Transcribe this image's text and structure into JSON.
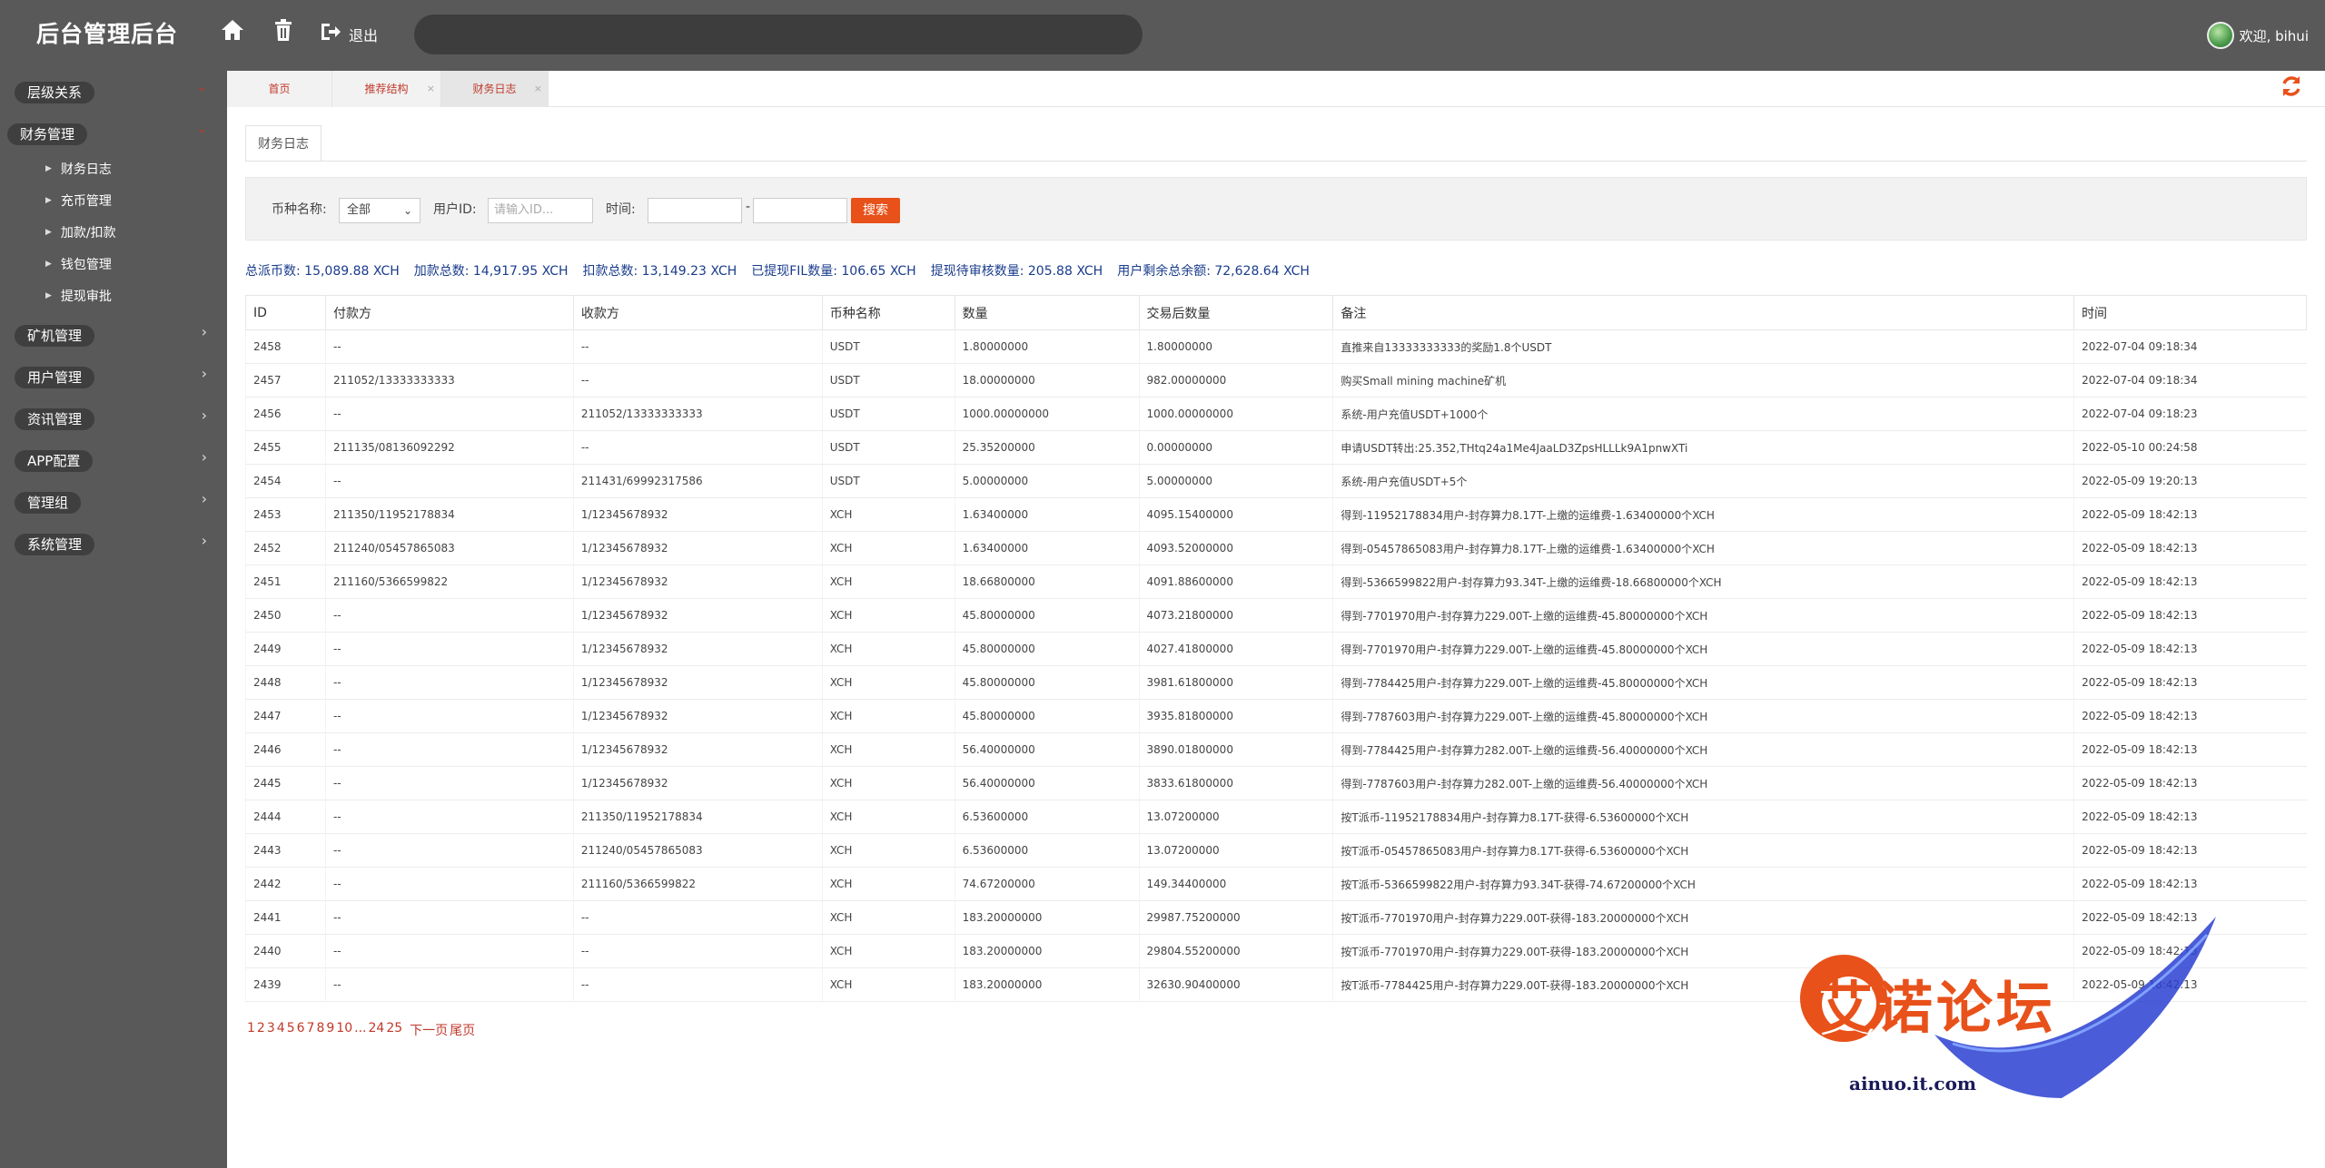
{
  "header": {
    "brand": "后台管理后台",
    "logout_label": "退出",
    "welcome": "欢迎, bihui"
  },
  "sidebar": {
    "groups": [
      {
        "label": "层级关系"
      },
      {
        "label": "财务管理"
      },
      {
        "label": "矿机管理"
      },
      {
        "label": "用户管理"
      },
      {
        "label": "资讯管理"
      },
      {
        "label": "APP配置"
      },
      {
        "label": "管理组"
      },
      {
        "label": "系统管理"
      }
    ],
    "finance_items": [
      "财务日志",
      "充币管理",
      "加款/扣款",
      "钱包管理",
      "提现审批"
    ]
  },
  "tabs": {
    "items": [
      "首页",
      "推荐结构",
      "财务日志"
    ],
    "close": "×"
  },
  "page": {
    "inner_tab": "财务日志"
  },
  "filter": {
    "coin_label": "币种名称:",
    "coin_value": "全部",
    "user_label": "用户ID:",
    "user_placeholder": "请输入ID...",
    "time_label": "时间:",
    "time_sep": "-",
    "search_button": "搜索"
  },
  "summary": [
    "总派币数: 15,089.88 XCH",
    "加款总数: 14,917.95 XCH",
    "扣款总数: 13,149.23 XCH",
    "已提现FIL数量: 106.65 XCH",
    "提现待审核数量: 205.88 XCH",
    "用户剩余总余额: 72,628.64 XCH"
  ],
  "table": {
    "headers": [
      "ID",
      "付款方",
      "收款方",
      "币种名称",
      "数量",
      "交易后数量",
      "备注",
      "时间"
    ],
    "rows": [
      [
        "2458",
        "--",
        "--",
        "USDT",
        "1.80000000",
        "1.80000000",
        "直推来自13333333333的奖励1.8个USDT",
        "2022-07-04 09:18:34"
      ],
      [
        "2457",
        "211052/13333333333",
        "--",
        "USDT",
        "18.00000000",
        "982.00000000",
        "购买Small mining machine矿机",
        "2022-07-04 09:18:34"
      ],
      [
        "2456",
        "--",
        "211052/13333333333",
        "USDT",
        "1000.00000000",
        "1000.00000000",
        "系统-用户充值USDT+1000个",
        "2022-07-04 09:18:23"
      ],
      [
        "2455",
        "211135/08136092292",
        "--",
        "USDT",
        "25.35200000",
        "0.00000000",
        "申请USDT转出:25.352,THtq24a1Me4JaaLD3ZpsHLLLk9A1pnwXTi",
        "2022-05-10 00:24:58"
      ],
      [
        "2454",
        "--",
        "211431/69992317586",
        "USDT",
        "5.00000000",
        "5.00000000",
        "系统-用户充值USDT+5个",
        "2022-05-09 19:20:13"
      ],
      [
        "2453",
        "211350/11952178834",
        "1/12345678932",
        "XCH",
        "1.63400000",
        "4095.15400000",
        "得到-11952178834用户-封存算力8.17T-上缴的运维费-1.63400000个XCH",
        "2022-05-09 18:42:13"
      ],
      [
        "2452",
        "211240/05457865083",
        "1/12345678932",
        "XCH",
        "1.63400000",
        "4093.52000000",
        "得到-05457865083用户-封存算力8.17T-上缴的运维费-1.63400000个XCH",
        "2022-05-09 18:42:13"
      ],
      [
        "2451",
        "211160/5366599822",
        "1/12345678932",
        "XCH",
        "18.66800000",
        "4091.88600000",
        "得到-5366599822用户-封存算力93.34T-上缴的运维费-18.66800000个XCH",
        "2022-05-09 18:42:13"
      ],
      [
        "2450",
        "--",
        "1/12345678932",
        "XCH",
        "45.80000000",
        "4073.21800000",
        "得到-7701970用户-封存算力229.00T-上缴的运维费-45.80000000个XCH",
        "2022-05-09 18:42:13"
      ],
      [
        "2449",
        "--",
        "1/12345678932",
        "XCH",
        "45.80000000",
        "4027.41800000",
        "得到-7701970用户-封存算力229.00T-上缴的运维费-45.80000000个XCH",
        "2022-05-09 18:42:13"
      ],
      [
        "2448",
        "--",
        "1/12345678932",
        "XCH",
        "45.80000000",
        "3981.61800000",
        "得到-7784425用户-封存算力229.00T-上缴的运维费-45.80000000个XCH",
        "2022-05-09 18:42:13"
      ],
      [
        "2447",
        "--",
        "1/12345678932",
        "XCH",
        "45.80000000",
        "3935.81800000",
        "得到-7787603用户-封存算力229.00T-上缴的运维费-45.80000000个XCH",
        "2022-05-09 18:42:13"
      ],
      [
        "2446",
        "--",
        "1/12345678932",
        "XCH",
        "56.40000000",
        "3890.01800000",
        "得到-7784425用户-封存算力282.00T-上缴的运维费-56.40000000个XCH",
        "2022-05-09 18:42:13"
      ],
      [
        "2445",
        "--",
        "1/12345678932",
        "XCH",
        "56.40000000",
        "3833.61800000",
        "得到-7787603用户-封存算力282.00T-上缴的运维费-56.40000000个XCH",
        "2022-05-09 18:42:13"
      ],
      [
        "2444",
        "--",
        "211350/11952178834",
        "XCH",
        "6.53600000",
        "13.07200000",
        "按T派币-11952178834用户-封存算力8.17T-获得-6.53600000个XCH",
        "2022-05-09 18:42:13"
      ],
      [
        "2443",
        "--",
        "211240/05457865083",
        "XCH",
        "6.53600000",
        "13.07200000",
        "按T派币-05457865083用户-封存算力8.17T-获得-6.53600000个XCH",
        "2022-05-09 18:42:13"
      ],
      [
        "2442",
        "--",
        "211160/5366599822",
        "XCH",
        "74.67200000",
        "149.34400000",
        "按T派币-5366599822用户-封存算力93.34T-获得-74.67200000个XCH",
        "2022-05-09 18:42:13"
      ],
      [
        "2441",
        "--",
        "--",
        "XCH",
        "183.20000000",
        "29987.75200000",
        "按T派币-7701970用户-封存算力229.00T-获得-183.20000000个XCH",
        "2022-05-09 18:42:13"
      ],
      [
        "2440",
        "--",
        "--",
        "XCH",
        "183.20000000",
        "29804.55200000",
        "按T派币-7701970用户-封存算力229.00T-获得-183.20000000个XCH",
        "2022-05-09 18:42:13"
      ],
      [
        "2439",
        "--",
        "--",
        "XCH",
        "183.20000000",
        "32630.90400000",
        "按T派币-7784425用户-封存算力229.00T-获得-183.20000000个XCH",
        "2022-05-09 18:42:13"
      ]
    ]
  },
  "pager": {
    "pages": [
      "1",
      "2",
      "3",
      "4",
      "5",
      "6",
      "7",
      "8",
      "9",
      "10",
      "...",
      "24",
      "25"
    ],
    "next": "下一页",
    "last": "尾页"
  },
  "watermark": {
    "text": "艾诺论坛",
    "url": "ainuo.it.com"
  },
  "colors": {
    "chrome": "#595959",
    "accent": "#e8511a",
    "link": "#c0392b",
    "summary": "#1a3c8c"
  }
}
